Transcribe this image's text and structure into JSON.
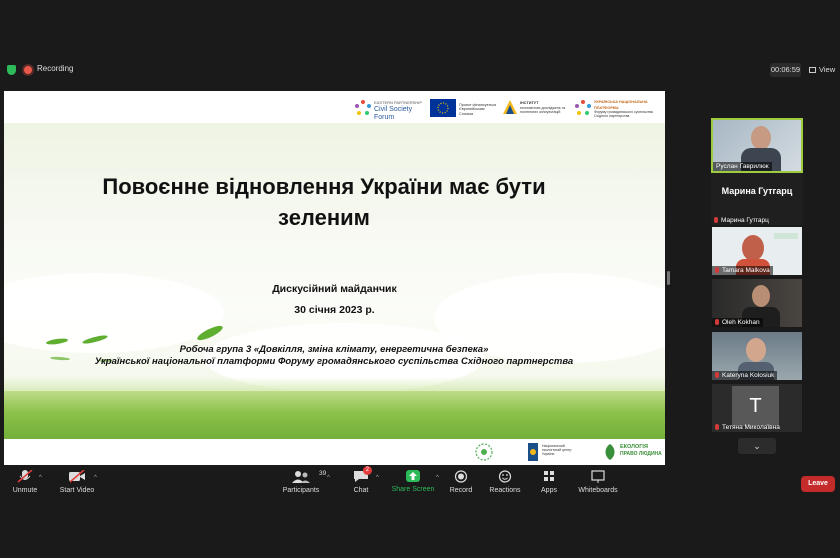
{
  "topbar": {
    "recording_label": "Recording",
    "timer": "00:06:59",
    "view_label": "View"
  },
  "slide": {
    "title": "Повоєнне відновлення України має бути зеленим",
    "subtitle": "Дискусійний майданчик",
    "date": "30 січня 2023 р.",
    "group_line1": "Робоча група 3 «Довкілля, зміна клімату, енергетична безпека»",
    "group_line2": "Української національної платформи Форуму громадянського суспільства Східного партнерства",
    "header_logos": {
      "csf_small": "EASTERN PARTNERSHIP",
      "csf_name": "Civil Society Forum",
      "eu_text": "Проект фінансується Європейським Союзом",
      "dif_name": "ІНСТИТУТ",
      "dif_text": "економічних досліджень та політичних консультацій",
      "platform_name": "УКРАЇНСЬКА НАЦІОНАЛЬНА ПЛАТФОРМА",
      "platform_text": "Форуму громадянського суспільства Східного партнерства"
    },
    "footer_logos": {
      "mid_text": "Національний екологічний центр України",
      "eco_line1": "ЕКОЛОГІЯ",
      "eco_line2": "ПРАВО ЛЮДИНА"
    }
  },
  "participants_panel": {
    "tiles": [
      {
        "name": "Руслан Гаврилюк",
        "type": "video",
        "active": true
      },
      {
        "name": "Марина Гутгарц",
        "big_name": "Марина Гутгарц",
        "type": "name"
      },
      {
        "name": "Tamara Malkova",
        "type": "video"
      },
      {
        "name": "Oleh Kokhan",
        "type": "video"
      },
      {
        "name": "Kateryna Kolosiuk",
        "type": "video"
      },
      {
        "name": "Тетяна Миколаївна",
        "initial": "T",
        "type": "avatar"
      }
    ]
  },
  "toolbar": {
    "unmute": "Unmute",
    "start_video": "Start Video",
    "participants": "Participants",
    "participants_count": "39",
    "chat": "Chat",
    "chat_badge": "2",
    "share_screen": "Share Screen",
    "record": "Record",
    "reactions": "Reactions",
    "apps": "Apps",
    "whiteboards": "Whiteboards",
    "leave": "Leave"
  },
  "colors": {
    "share_green": "#2dbb5a",
    "leave_red": "#c42b2b",
    "active_tile_border": "#9ecc3f",
    "grass_green": "#72b03a"
  }
}
